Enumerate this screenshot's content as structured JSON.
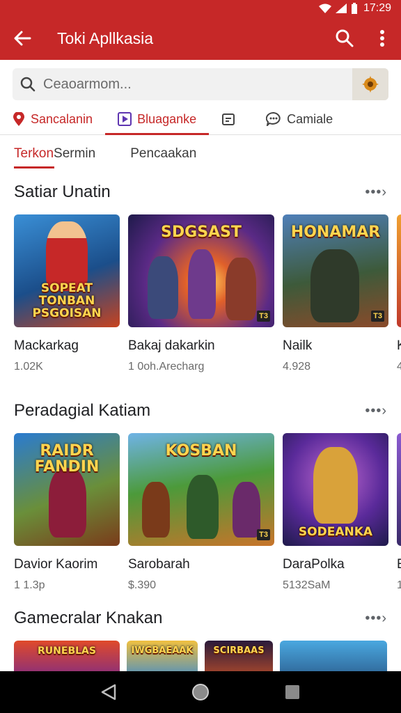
{
  "status_bar": {
    "time": "17:29"
  },
  "app_bar": {
    "title": "Toki Apllkasia",
    "back_icon": "arrow-left-icon",
    "search_icon": "search-icon",
    "more_icon": "more-vertical-icon"
  },
  "search": {
    "placeholder": "Ceaoarmom..."
  },
  "category_tabs": [
    {
      "label": "Sancalanin",
      "icon": "location-pin-icon"
    },
    {
      "label": "Bluaganke",
      "icon": "play-icon"
    },
    {
      "label": "",
      "icon": "calendar-icon"
    },
    {
      "label": "Camiale",
      "icon": "chat-icon"
    }
  ],
  "sub_tabs": {
    "active_a": "Terkon",
    "active_b": " Sermin",
    "second": "Pencaakan"
  },
  "sections": [
    {
      "title": "Satiar Unatin",
      "more": "•••›",
      "items": [
        {
          "name": "Mackarkag",
          "meta": "1.02K",
          "art_text": "SOPEAT TONBAN PSGOISAN"
        },
        {
          "name": "Bakaj dakarkin",
          "meta": "1 0oh.Arecharg",
          "art_text": "SDGSAST",
          "badge": "T3"
        },
        {
          "name": "Nailk",
          "meta": "4.928",
          "art_text": "HONAMAR",
          "badge": "T3"
        },
        {
          "name": "K",
          "meta": "4"
        }
      ]
    },
    {
      "title": "Peradagial Katiam",
      "more": "•••›",
      "items": [
        {
          "name": "Davior Kaorim",
          "meta": "1 1.3p",
          "art_text": "RAIDR FANDIN"
        },
        {
          "name": "Sarobarah",
          "meta": "$.390",
          "art_text": "KOSBAN",
          "badge": "T3"
        },
        {
          "name": "DaraPolka",
          "meta": "5132SaM",
          "art_text": "SODEANKA"
        },
        {
          "name": "E",
          "meta": "1"
        }
      ]
    },
    {
      "title": "Gamecralar Knakan",
      "more": "•••›",
      "items": [
        {
          "art_text": "RUNEBLAS"
        },
        {
          "art_text": "IWGBAEAAK"
        },
        {
          "art_text": "SCIRBAAS"
        },
        {
          "art_text": ""
        }
      ]
    }
  ],
  "nav_bar": {
    "back_icon": "triangle-back-icon",
    "home_icon": "circle-home-icon",
    "recents_icon": "square-recents-icon"
  },
  "colors": {
    "primary": "#c62828",
    "status_text": "#ffffff",
    "nav_bg": "#000000"
  }
}
